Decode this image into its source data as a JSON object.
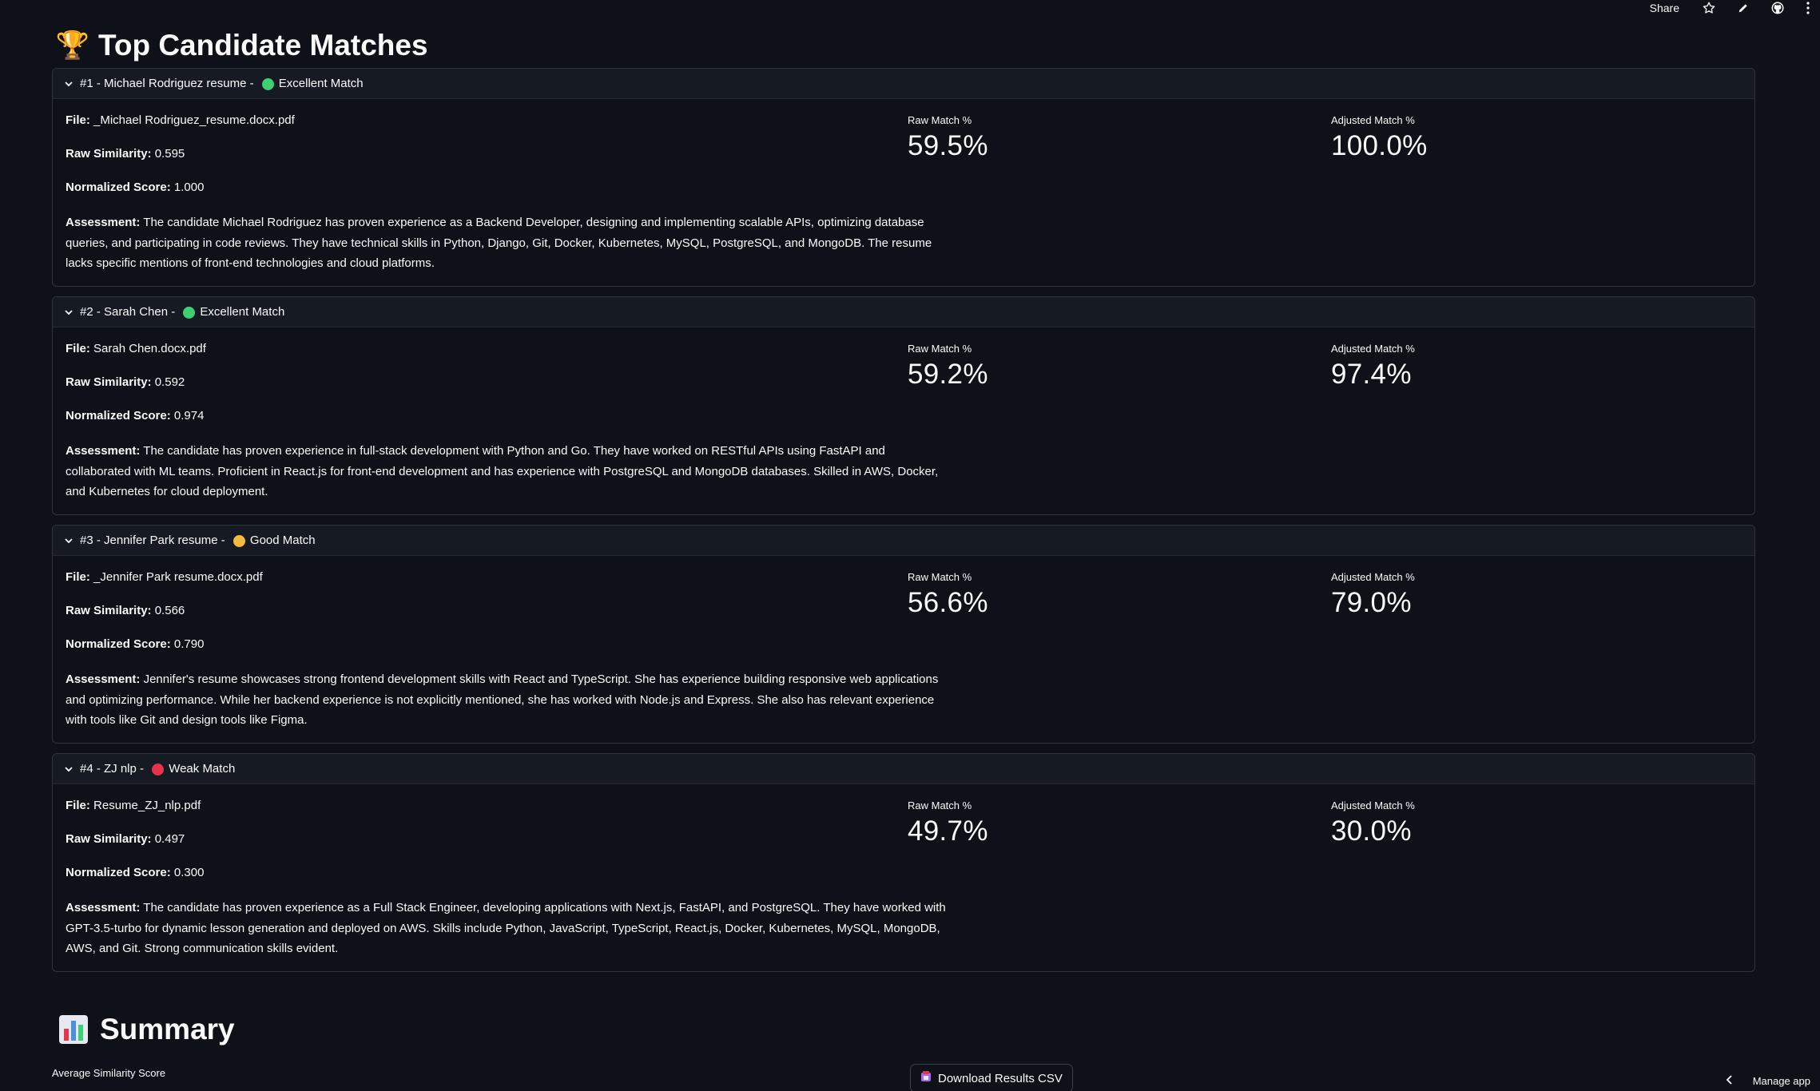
{
  "topbar": {
    "share_label": "Share"
  },
  "page": {
    "title_emoji": "🏆",
    "title": "Top Candidate Matches"
  },
  "labels": {
    "file": "File:",
    "raw_similarity": "Raw Similarity:",
    "normalized_score": "Normalized Score:",
    "assessment": "Assessment:",
    "raw_match": "Raw Match %",
    "adjusted_match": "Adjusted Match %"
  },
  "candidates": [
    {
      "header": "#1 - Michael Rodriguez resume - ",
      "match_label": "Excellent Match",
      "match_color": "#3ecf73",
      "file": "_Michael Rodriguez_resume.docx.pdf",
      "raw_similarity": "0.595",
      "normalized_score": "1.000",
      "assessment": "The candidate Michael Rodriguez has proven experience as a Backend Developer, designing and implementing scalable APIs, optimizing database queries, and participating in code reviews. They have technical skills in Python, Django, Git, Docker, Kubernetes, MySQL, PostgreSQL, and MongoDB. The resume lacks specific mentions of front-end technologies and cloud platforms.",
      "raw_match": "59.5%",
      "adjusted_match": "100.0%"
    },
    {
      "header": "#2 - Sarah Chen - ",
      "match_label": "Excellent Match",
      "match_color": "#3ecf73",
      "file": "Sarah Chen.docx.pdf",
      "raw_similarity": "0.592",
      "normalized_score": "0.974",
      "assessment": "The candidate has proven experience in full-stack development with Python and Go. They have worked on RESTful APIs using FastAPI and collaborated with ML teams. Proficient in React.js for front-end development and has experience with PostgreSQL and MongoDB databases. Skilled in AWS, Docker, and Kubernetes for cloud deployment.",
      "raw_match": "59.2%",
      "adjusted_match": "97.4%"
    },
    {
      "header": "#3 - Jennifer Park resume - ",
      "match_label": "Good Match",
      "match_color": "#f5b942",
      "file": "_Jennifer Park resume.docx.pdf",
      "raw_similarity": "0.566",
      "normalized_score": "0.790",
      "assessment": "Jennifer's resume showcases strong frontend development skills with React and TypeScript. She has experience building responsive web applications and optimizing performance. While her backend experience is not explicitly mentioned, she has worked with Node.js and Express. She also has relevant experience with tools like Git and design tools like Figma.",
      "raw_match": "56.6%",
      "adjusted_match": "79.0%"
    },
    {
      "header": "#4 - ZJ nlp - ",
      "match_label": "Weak Match",
      "match_color": "#e8344a",
      "file": "Resume_ZJ_nlp.pdf",
      "raw_similarity": "0.497",
      "normalized_score": "0.300",
      "assessment": "The candidate has proven experience as a Full Stack Engineer, developing applications with Next.js, FastAPI, and PostgreSQL. They have worked with GPT-3.5-turbo for dynamic lesson generation and deployed on AWS. Skills include Python, JavaScript, TypeScript, React.js, Docker, Kubernetes, MySQL, MongoDB, AWS, and Git. Strong communication skills evident.",
      "raw_match": "49.7%",
      "adjusted_match": "30.0%"
    }
  ],
  "summary": {
    "title": "Summary",
    "avg_label": "Average Similarity Score",
    "download_label": "Download Results CSV"
  },
  "footer": {
    "manage_app": "Manage app"
  },
  "icons": {
    "star": "star-icon",
    "edit": "pencil-icon",
    "github": "github-icon",
    "menu": "kebab-menu-icon",
    "chevron": "chevron-down-icon",
    "chart": "bar-chart-icon",
    "download": "download-icon"
  }
}
